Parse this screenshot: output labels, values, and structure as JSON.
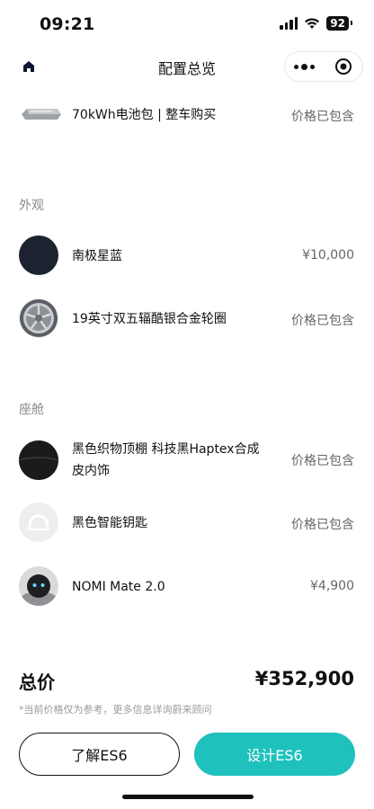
{
  "status_bar": {
    "time": "09:21",
    "battery": "92"
  },
  "nav": {
    "title": "配置总览"
  },
  "battery_pack": {
    "label": "70kWh电池包 | 整车购买",
    "price": "价格已包含"
  },
  "exterior": {
    "title": "外观",
    "items": [
      {
        "label": "南极星蓝",
        "price": "¥10,000"
      },
      {
        "label": "19英寸双五辐酷银合金轮圈",
        "price": "价格已包含"
      }
    ]
  },
  "cabin": {
    "title": "座舱",
    "items": [
      {
        "label_line1": "黑色织物顶棚 科技黑Haptex合成",
        "label_line2": "皮内饰",
        "price": "价格已包含"
      },
      {
        "label": "黑色智能钥匙",
        "price": "价格已包含"
      },
      {
        "label": "NOMI Mate 2.0",
        "price": "¥4,900"
      }
    ]
  },
  "summary": {
    "total_label": "总价",
    "total_value": "¥352,900",
    "note": "*当前价格仅为参考，更多信息详询蔚来顾问"
  },
  "buttons": {
    "learn": "了解ES6",
    "design": "设计ES6"
  },
  "colors": {
    "accent": "#1fc1bd",
    "paint": "#1c2230"
  }
}
